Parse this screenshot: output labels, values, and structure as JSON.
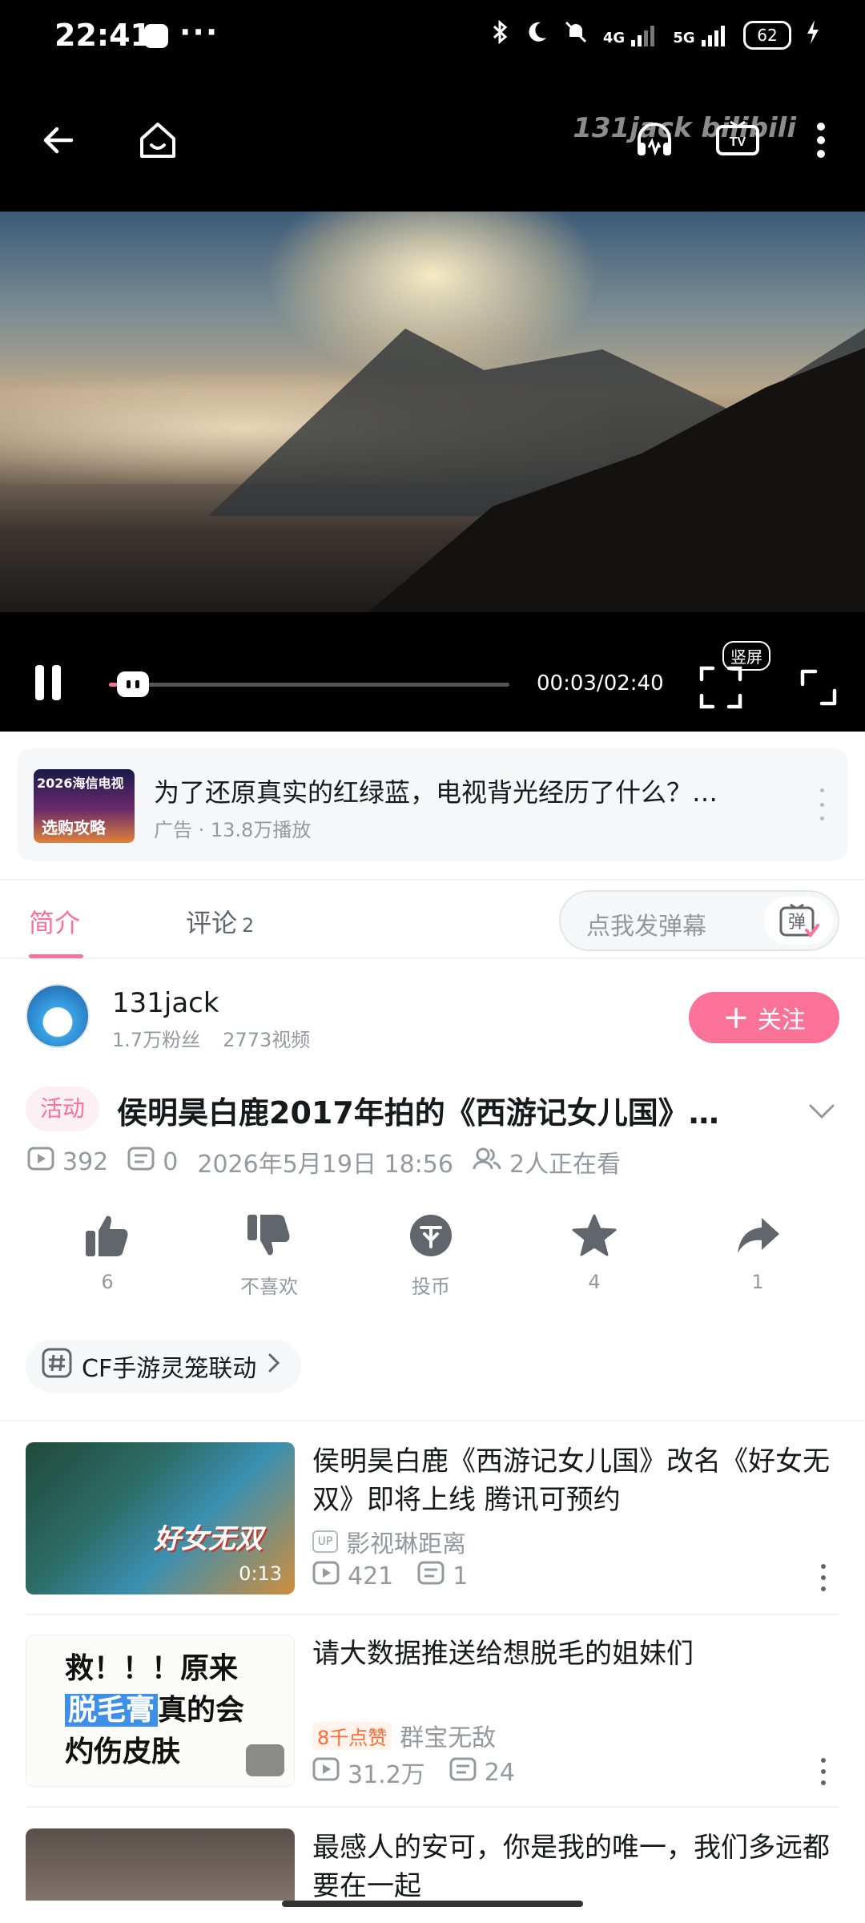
{
  "status_bar": {
    "time": "22:41",
    "more": "···",
    "network1": "4G",
    "network2": "5G",
    "battery": "62"
  },
  "video": {
    "watermark": "131jack bilibili",
    "time_display": "00:03/02:40",
    "progress": 0.02,
    "vertical_screen_label": "竖屏",
    "icons": [
      "back-arrow-icon",
      "home-icon",
      "headphones-icon",
      "tv-cast-icon",
      "more-vertical-icon",
      "pause-icon",
      "fullscreen-icon",
      "expand-icon"
    ]
  },
  "ad": {
    "thumb_top": "2026海信电视",
    "thumb_bottom": "选购攻略",
    "title": "为了还原真实的红绿蓝，电视背光经历了什么？…",
    "meta": "广告 · 13.8万播放"
  },
  "tabs": {
    "intro": "简介",
    "comments": "评论",
    "comments_count": "2",
    "danmaku_placeholder": "点我发弹幕",
    "danmaku_button": "弹"
  },
  "uploader": {
    "name": "131jack",
    "fans": "1.7万粉丝",
    "videos": "2773视频",
    "follow_label": "关注"
  },
  "video_info": {
    "tag": "活动",
    "title": "侯明昊白鹿2017年拍的《西游记女儿国》…",
    "plays": "392",
    "danmaku": "0",
    "date": "2026年5月19日 18:56",
    "watching": "2人正在看"
  },
  "actions": [
    {
      "name": "like",
      "label": "6"
    },
    {
      "name": "dislike",
      "label": "不喜欢"
    },
    {
      "name": "coin",
      "label": "投币"
    },
    {
      "name": "favorite",
      "label": "4"
    },
    {
      "name": "share",
      "label": "1"
    }
  ],
  "topic": {
    "label": "CF手游灵笼联动"
  },
  "recommendations": [
    {
      "title": "侯明昊白鹿《西游记女儿国》改名《好女无双》即将上线 腾讯可预约",
      "thumb_text": "好女无双",
      "duration": "0:13",
      "up_badge": "UP",
      "uploader": "影视琳距离",
      "plays": "421",
      "danmaku": "1"
    },
    {
      "title": "请大数据推送给想脱毛的姐妹们",
      "thumb_line1": "救！！！原来",
      "thumb_line2_hl": "脱毛膏",
      "thumb_line2": "真的会",
      "thumb_line3": "灼伤皮肤",
      "hot_badge": "8千点赞",
      "uploader": "群宝无敌",
      "plays": "31.2万",
      "danmaku": "24"
    },
    {
      "title": "最感人的安可，你是我的唯一，我们多远都要在一起"
    }
  ],
  "colors": {
    "accent": "#fb7299",
    "text_primary": "#18191c",
    "text_secondary": "#9499a0"
  }
}
